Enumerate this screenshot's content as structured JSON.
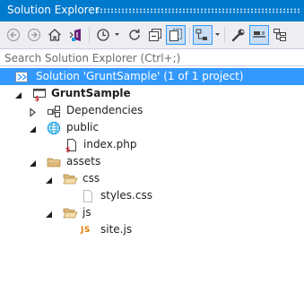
{
  "window": {
    "title": "Solution Explorer"
  },
  "toolbar": {
    "buttons": [
      {
        "name": "back-icon"
      },
      {
        "name": "forward-icon"
      },
      {
        "name": "home-icon"
      },
      {
        "name": "vs-switch-views-icon"
      },
      {
        "name": "history-icon"
      },
      {
        "name": "refresh-icon"
      },
      {
        "name": "collapse-all-icon"
      },
      {
        "name": "show-all-files-icon",
        "active": true
      },
      {
        "name": "pending-changes-filter-icon",
        "active": true
      },
      {
        "name": "properties-wrench-icon"
      },
      {
        "name": "preview-selected-items-icon",
        "active": true
      },
      {
        "name": "class-diagram-icon"
      }
    ]
  },
  "search": {
    "placeholder": "Search Solution Explorer (Ctrl+;)",
    "value": ""
  },
  "tree": {
    "solution": {
      "label": "Solution 'GruntSample' (1 of 1 project)",
      "icon": "solution-icon",
      "selected": true
    },
    "project": {
      "label": "GruntSample",
      "icon": "web-project-icon",
      "expanded": true
    },
    "items": {
      "dependencies": {
        "label": "Dependencies",
        "icon": "dependencies-icon",
        "expanded": false
      },
      "public": {
        "label": "public",
        "icon": "globe-icon",
        "expanded": true
      },
      "index_php": {
        "label": "index.php",
        "icon": "php-file-icon"
      },
      "assets": {
        "label": "assets",
        "icon": "folder-icon",
        "expanded": true
      },
      "css": {
        "label": "css",
        "icon": "folder-open-icon",
        "expanded": true
      },
      "styles_css": {
        "label": "styles.css",
        "icon": "css-file-icon"
      },
      "js": {
        "label": "js",
        "icon": "folder-open-icon",
        "expanded": true
      },
      "site_js": {
        "label": "site.js",
        "icon": "js-file-icon",
        "glyph": "JS"
      }
    }
  },
  "colors": {
    "titlebar": "#007acc",
    "selection": "#3399ff",
    "toolbar_bg": "#eeeef2",
    "folder": "#dcb67a",
    "globe": "#1ba1e2",
    "js": "#e07c00",
    "php_red": "#c1272d"
  }
}
